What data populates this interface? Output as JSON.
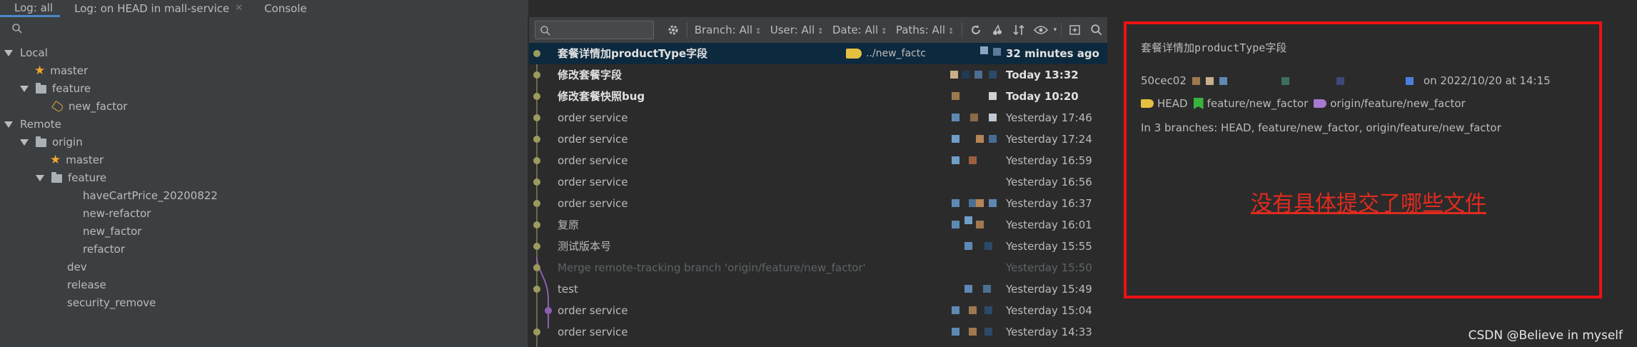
{
  "tabs": [
    {
      "label": "Log: all",
      "active": true,
      "closable": false
    },
    {
      "label": "Log: on HEAD in mall-service",
      "active": false,
      "closable": true
    },
    {
      "label": "Console",
      "active": false,
      "closable": false
    }
  ],
  "branches": {
    "local_label": "Local",
    "local_master": "master",
    "local_feature": "feature",
    "local_new_factor": "new_factor",
    "remote_label": "Remote",
    "origin": "origin",
    "origin_master": "master",
    "origin_feature": "feature",
    "origin_feature_items": [
      "haveCartPrice_20200822",
      "new-refactor",
      "new_factor",
      "refactor"
    ],
    "origin_other": [
      "dev",
      "release",
      "security_remove"
    ]
  },
  "toolbar": {
    "filter_placeholder": "",
    "branch": "Branch: All",
    "user": "User: All",
    "date": "Date: All",
    "paths": "Paths: All"
  },
  "commits": [
    {
      "message": "套餐详情加productType字段",
      "date": "32 minutes ago",
      "bold": true,
      "selected": true,
      "refs": "../new_factc"
    },
    {
      "message": "修改套餐字段",
      "date": "Today 13:32",
      "bold": true
    },
    {
      "message": "修改套餐快照bug",
      "date": "Today 10:20",
      "bold": true
    },
    {
      "message": "order service",
      "date": "Yesterday 17:46"
    },
    {
      "message": "order service",
      "date": "Yesterday 17:24"
    },
    {
      "message": "order service",
      "date": "Yesterday 16:59"
    },
    {
      "message": "order service",
      "date": "Yesterday 16:56"
    },
    {
      "message": "order service",
      "date": "Yesterday 16:37"
    },
    {
      "message": "复原",
      "date": "Yesterday 16:01"
    },
    {
      "message": "测试版本号",
      "date": "Yesterday 15:55"
    },
    {
      "message": "Merge remote-tracking branch 'origin/feature/new_factor' into featur",
      "date": "Yesterday 15:50",
      "dim": true
    },
    {
      "message": "test",
      "date": "Yesterday 15:49"
    },
    {
      "message": "order service",
      "date": "Yesterday 15:04"
    },
    {
      "message": "order service",
      "date": "Yesterday 14:33"
    }
  ],
  "detail": {
    "title": "套餐详情加productType字段",
    "hash": "50cec02",
    "date_text": "on 2022/10/20 at 14:15",
    "refs": [
      "HEAD",
      "feature/new_factor",
      "origin/feature/new_factor"
    ],
    "branches_text": "In 3 branches: HEAD, feature/new_factor, origin/feature/new_factor"
  },
  "annotation": "没有具体提交了哪些文件",
  "watermark": "CSDN @Believe in myself",
  "colors": {
    "annotation": "#e12b1f",
    "highlight_box": "#ee1111",
    "selected_row": "#0d293e"
  }
}
